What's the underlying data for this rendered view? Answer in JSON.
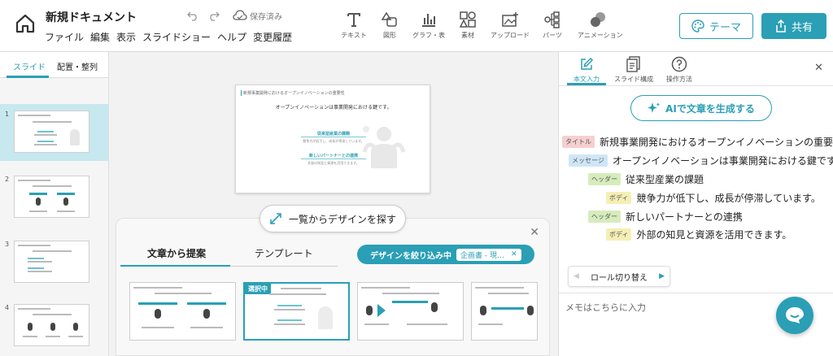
{
  "header": {
    "doc_title": "新規ドキュメント",
    "menu": [
      "ファイル",
      "編集",
      "表示",
      "スライドショー",
      "ヘルプ",
      "変更履歴"
    ],
    "save_status": "保存済み",
    "tools": [
      {
        "label": "テキスト",
        "icon": "text-icon"
      },
      {
        "label": "図形",
        "icon": "shapes-icon"
      },
      {
        "label": "グラフ・表",
        "icon": "chart-icon"
      },
      {
        "label": "素材",
        "icon": "assets-icon"
      },
      {
        "label": "アップロード",
        "icon": "upload-icon"
      },
      {
        "label": "パーツ",
        "icon": "parts-icon"
      },
      {
        "label": "アニメーション",
        "icon": "animation-icon"
      }
    ],
    "theme_label": "テーマ",
    "share_label": "共有"
  },
  "left_panel": {
    "tabs": [
      "スライド",
      "配置・整列"
    ],
    "active_tab": 0,
    "slides": [
      1,
      2,
      3,
      4
    ],
    "active_slide": 1
  },
  "slide": {
    "header": "新規事業開発におけるオープンイノベーションの重要性",
    "message": "オープンイノベーションは事業開発における鍵です。",
    "heading1": "従来型産業の課題",
    "body1": "競争力が低下し、成長が停滞しています。",
    "heading2": "新しいパートナーとの連携",
    "body2": "外部の知見と資源を活用できます。"
  },
  "design_panel": {
    "browse_label": "一覧からデザインを探す",
    "tabs": [
      "文章から提案",
      "テンプレート"
    ],
    "active_tab": 0,
    "filter_label": "デザインを絞り込み中",
    "filter_chip": "企画書 - 現…",
    "selected_badge": "選択中",
    "cards": 4,
    "selected_card": 1
  },
  "right_panel": {
    "tabs": [
      {
        "label": "本文入力",
        "icon": "edit-icon"
      },
      {
        "label": "スライド構成",
        "icon": "document-icon"
      },
      {
        "label": "操作方法",
        "icon": "help-icon"
      }
    ],
    "active_tab": 0,
    "ai_button": "AIで文章を生成する",
    "roles": [
      {
        "tag": "タイトル",
        "kind": "title",
        "text": "新規事業開発におけるオープンイノベーションの重要性"
      },
      {
        "tag": "メッセージ",
        "kind": "msg",
        "text": "オープンイノベーションは事業開発における鍵です。"
      },
      {
        "tag": "ヘッダー",
        "kind": "head",
        "text": "従来型産業の課題"
      },
      {
        "tag": "ボディ",
        "kind": "body",
        "text": "競争力が低下し、成長が停滞しています。"
      },
      {
        "tag": "ヘッダー",
        "kind": "head",
        "text": "新しいパートナーとの連携"
      },
      {
        "tag": "ボディ",
        "kind": "body",
        "text": "外部の知見と資源を活用できます。"
      }
    ],
    "role_switch": "ロール切り替え",
    "memo_placeholder": "メモはこちらに入力"
  },
  "colors": {
    "accent": "#2a9fb5",
    "title_tag": "#f6cfd0",
    "msg_tag": "#cfe6f7",
    "head_tag": "#d7ecbd",
    "body_tag": "#f5efb6"
  }
}
